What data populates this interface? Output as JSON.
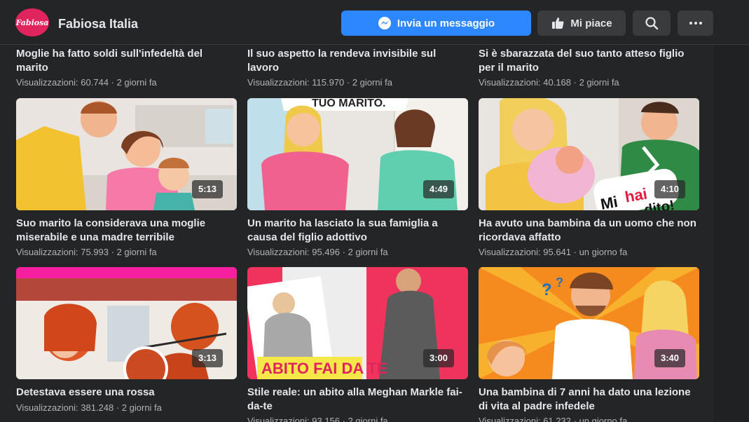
{
  "header": {
    "logo_text": "Fabiosa",
    "page_name": "Fabiosa Italia",
    "message_button": "Invia un messaggio",
    "like_button": "Mi piace",
    "search_icon": "search-icon",
    "more_icon": "more-icon"
  },
  "videos": [
    {
      "title": "Moglie ha fatto soldi sull'infedeltà del marito",
      "meta": "Visualizzazioni: 60.744 · 2 giorni fa",
      "duration": ""
    },
    {
      "title": "Il suo aspetto la rendeva invisibile sul lavoro",
      "meta": "Visualizzazioni: 115.970 · 2 giorni fa",
      "duration": ""
    },
    {
      "title": "Si è sbarazzata del suo tanto atteso figlio per il marito",
      "meta": "Visualizzazioni: 40.168 · 2 giorni fa",
      "duration": ""
    },
    {
      "title": "Suo marito la considerava una moglie miserabile e una madre terribile",
      "meta": "Visualizzazioni: 75.993 · 2 giorni fa",
      "duration": "5:13"
    },
    {
      "title": "Un marito ha lasciato la sua famiglia a causa del figlio adottivo",
      "meta": "Visualizzazioni: 95.496 · 2 giorni fa",
      "duration": "4:49",
      "thumb_text": "TUO MARITO."
    },
    {
      "title": "Ha avuto una bambina da un uomo che non ricordava affatto",
      "meta": "Visualizzazioni: 95.641 · un giorno fa",
      "duration": "4:10",
      "thumb_text_1": "Mi",
      "thumb_text_2": "hai",
      "thumb_text_3": "dito!"
    },
    {
      "title": "Detestava essere una rossa",
      "meta": "Visualizzazioni: 381.248 · 2 giorni fa",
      "duration": "3:13"
    },
    {
      "title": "Stile reale: un abito alla Meghan Markle fai-da-te",
      "meta": "Visualizzazioni: 93.156 · 2 giorni fa",
      "duration": "3:00",
      "thumb_text": "ABITO FAI DA TE"
    },
    {
      "title": "Una bambina di 7 anni ha dato una lezione di vita al padre infedele",
      "meta": "Visualizzazioni: 61.232 · un giorno fa",
      "duration": "3:40"
    }
  ],
  "colors": {
    "accent": "#2d88ff",
    "background": "#18191a",
    "panel": "#242526",
    "logo": "#e0245e"
  }
}
